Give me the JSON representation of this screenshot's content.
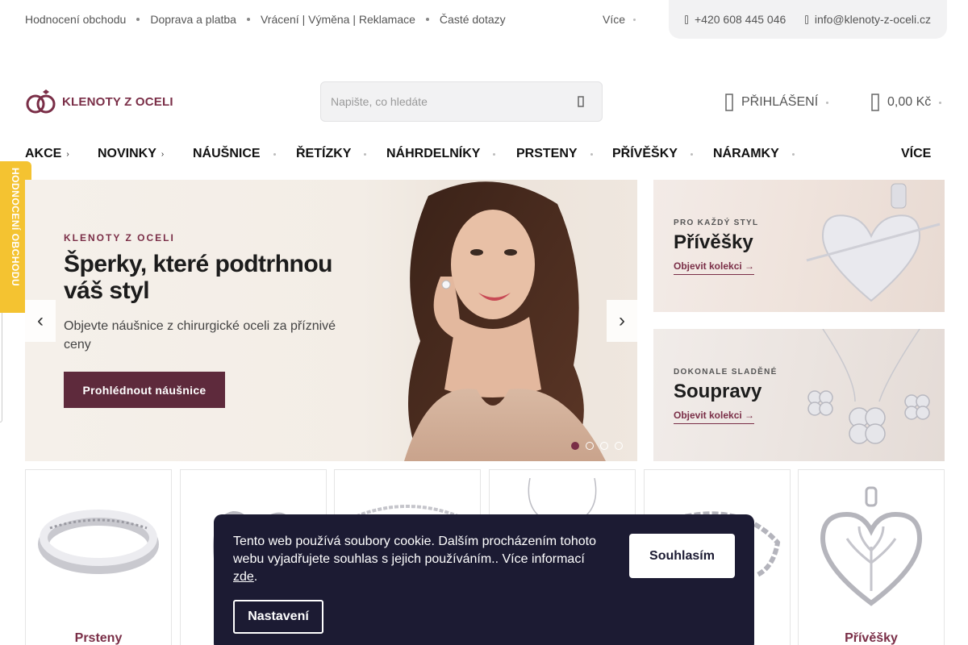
{
  "topbar": {
    "links": [
      "Hodnocení obchodu",
      "Doprava a platba",
      "Vrácení | Výměna | Reklamace",
      "Časté dotazy"
    ],
    "more": "Více",
    "phone": "+420 608 445 046",
    "email": "info@klenoty-z-oceli.cz"
  },
  "header": {
    "logo_text": "KLENOTY Z OCELI",
    "search_placeholder": "Napište, co hledáte",
    "login": "PŘIHLÁŠENÍ",
    "cart_total": "0,00 Kč"
  },
  "nav": {
    "items": [
      {
        "label": "AKCE",
        "arrow": "›"
      },
      {
        "label": "NOVINKY",
        "arrow": "›"
      },
      {
        "label": "NÁUŠNICE",
        "arrow": ""
      },
      {
        "label": "ŘETÍZKY",
        "arrow": ""
      },
      {
        "label": "NÁHRDELNÍKY",
        "arrow": ""
      },
      {
        "label": "PRSTENY",
        "arrow": ""
      },
      {
        "label": "PŘÍVĚŠKY",
        "arrow": ""
      },
      {
        "label": "NÁRAMKY",
        "arrow": ""
      }
    ],
    "more": "VÍCE"
  },
  "side_tab": {
    "label": "HODNOCENÍ OBCHODU"
  },
  "hero": {
    "eyebrow": "KLENOTY Z OCELI",
    "title": "Šperky, které podtrhnou váš styl",
    "subtitle": "Objevte náušnice z chirurgické oceli za příznivé ceny",
    "button": "Prohlédnout náušnice",
    "prev": "‹",
    "next": "›",
    "slides_count": 4,
    "active_slide": 1
  },
  "promos": [
    {
      "eyebrow": "PRO KAŽDÝ STYL",
      "title": "Přívěšky",
      "link": "Objevit kolekci →"
    },
    {
      "eyebrow": "DOKONALE SLADĚNÉ",
      "title": "Soupravy",
      "link": "Objevit kolekci →"
    }
  ],
  "categories": [
    {
      "label": "Prsteny",
      "icon": "ring-image"
    },
    {
      "label": "",
      "icon": "earrings-image"
    },
    {
      "label": "",
      "icon": "bracelet-image"
    },
    {
      "label": "",
      "icon": "necklace-image"
    },
    {
      "label": "",
      "icon": "chain-bracelet-image"
    },
    {
      "label": "Přívěšky",
      "icon": "heart-pendant-image"
    }
  ],
  "cookie": {
    "text": "Tento web používá soubory cookie. Dalším procházením tohoto webu vyjadřujete souhlas s jejich používáním.. Více informací",
    "link": "zde",
    "after_link": ".",
    "accept": "Souhlasím",
    "settings": "Nastavení"
  },
  "colors": {
    "brand": "#7a2e47",
    "button_dark": "#5e2a3c",
    "cookie_bg": "#1c1b33",
    "side_tab": "#f4c331"
  }
}
